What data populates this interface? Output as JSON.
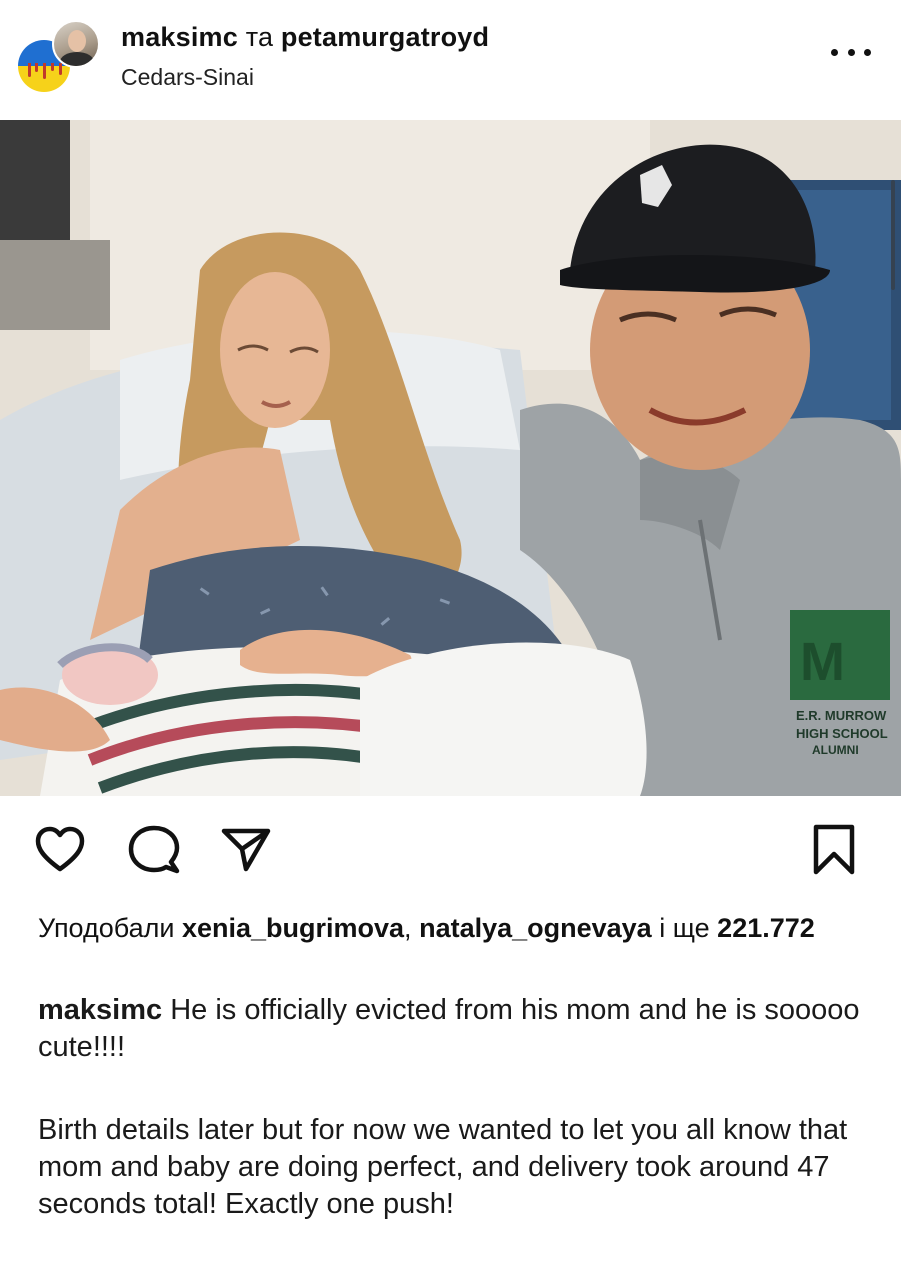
{
  "post_header": {
    "author": "maksimc",
    "joiner": "та",
    "coauthor": "petamurgatroyd",
    "location": "Cedars-Sinai",
    "more_icon": "more-horizontal-icon"
  },
  "photo": {
    "description_icon": "post-photo",
    "cap_text": "",
    "sweatshirt_text": "E.R. MURROW HIGH SCHOOL ALUMNI"
  },
  "actions": {
    "like_icon": "heart-icon",
    "comment_icon": "comment-icon",
    "share_icon": "send-icon",
    "save_icon": "bookmark-icon"
  },
  "likes": {
    "prefix": "Уподобали",
    "user1": "xenia_bugrimova",
    "separator": ",",
    "user2": "natalya_ognevaya",
    "and_more": "і ще",
    "count": "221.772"
  },
  "caption": {
    "user": "maksimc",
    "line1": "He is officially evicted from his mom and he is sooooo cute!!!!",
    "paragraph2": "Birth details later but for now we wanted to let you all know that mom and baby are doing perfect, and delivery took  around 47 seconds total! Exactly one push!"
  },
  "colors": {
    "flag_blue": "#1f6fd1",
    "flag_yellow": "#f6d21a",
    "text": "#111111"
  }
}
